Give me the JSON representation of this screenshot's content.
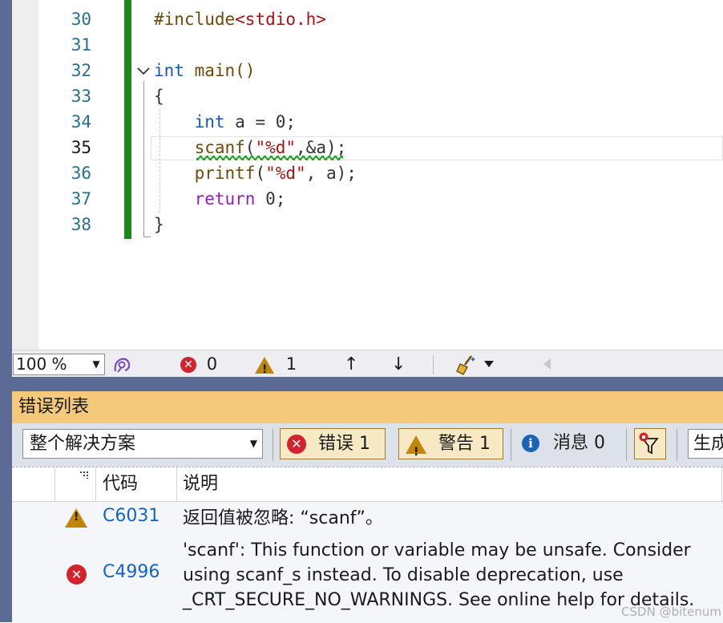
{
  "editor": {
    "lines": [
      {
        "num": "30",
        "tokens": [
          {
            "t": "#include",
            "c": "pp"
          },
          {
            "t": "<stdio.h>",
            "c": "str"
          }
        ]
      },
      {
        "num": "31",
        "tokens": []
      },
      {
        "num": "32",
        "tokens": [
          {
            "t": "int",
            "c": "kw"
          },
          {
            "t": " main()",
            "c": "fn"
          }
        ]
      },
      {
        "num": "33",
        "tokens": [
          {
            "t": "{",
            "c": "plain"
          }
        ]
      },
      {
        "num": "34",
        "tokens": [
          {
            "t": "    ",
            "c": "plain"
          },
          {
            "t": "int",
            "c": "kw"
          },
          {
            "t": " a = 0;",
            "c": "plain"
          }
        ]
      },
      {
        "num": "35",
        "tokens": [
          {
            "t": "    ",
            "c": "plain"
          },
          {
            "t": "scanf",
            "c": "fn"
          },
          {
            "t": "(",
            "c": "plain"
          },
          {
            "t": "\"%d\"",
            "c": "str"
          },
          {
            "t": ",&a);",
            "c": "plain"
          }
        ]
      },
      {
        "num": "36",
        "tokens": [
          {
            "t": "    ",
            "c": "plain"
          },
          {
            "t": "printf",
            "c": "fn"
          },
          {
            "t": "(",
            "c": "plain"
          },
          {
            "t": "\"%d\"",
            "c": "str"
          },
          {
            "t": ", a);",
            "c": "plain"
          }
        ]
      },
      {
        "num": "37",
        "tokens": [
          {
            "t": "    ",
            "c": "plain"
          },
          {
            "t": "return",
            "c": "ret"
          },
          {
            "t": " 0;",
            "c": "plain"
          }
        ]
      },
      {
        "num": "38",
        "tokens": [
          {
            "t": "}",
            "c": "plain"
          }
        ]
      }
    ],
    "current_line": "35",
    "fold_icon": "chevron-down-icon"
  },
  "status_bar": {
    "zoom": "100 %",
    "errors_count": "0",
    "warnings_count": "1"
  },
  "error_list": {
    "title": "错误列表",
    "scope": "整个解决方案",
    "errors_button": "错误 1",
    "warnings_button": "警告 1",
    "messages_button": "消息 0",
    "build_select": "生成",
    "columns": {
      "code": "代码",
      "description": "说明"
    },
    "rows": [
      {
        "severity": "warning",
        "code": "C6031",
        "description": "返回值被忽略: “scanf”。"
      },
      {
        "severity": "error",
        "code": "C4996",
        "description": "'scanf': This function or variable may be unsafe. Consider using scanf_s instead. To disable deprecation, use _CRT_SECURE_NO_WARNINGS. See online help for details."
      }
    ]
  },
  "watermark": "CSDN @bitenum",
  "colors": {
    "keyword": "#1a55b5",
    "string": "#a31515",
    "error_red": "#d0242e",
    "warning_amber": "#c0860c",
    "header_bg": "#f5c97c",
    "frame_blue": "#5c6b96"
  }
}
